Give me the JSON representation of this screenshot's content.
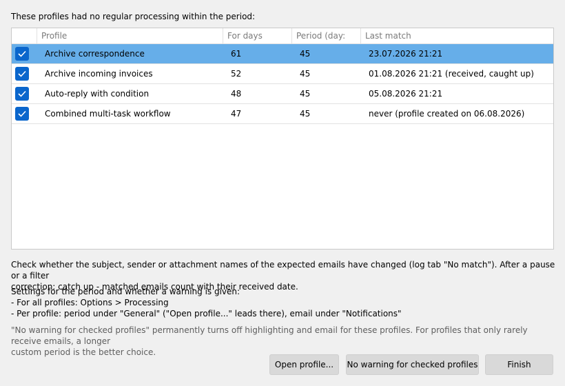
{
  "heading": "These profiles had no regular processing within the period:",
  "table": {
    "columns": {
      "profile": "Profile",
      "days": "For days",
      "period": "Period (day:",
      "last": "Last match"
    },
    "rows": [
      {
        "checked": true,
        "selected": true,
        "profile": "Archive correspondence",
        "days": "61",
        "period": "45",
        "last": "23.07.2026 21:21"
      },
      {
        "checked": true,
        "selected": false,
        "profile": "Archive incoming invoices",
        "days": "52",
        "period": "45",
        "last": "01.08.2026 21:21 (received, caught up)"
      },
      {
        "checked": true,
        "selected": false,
        "profile": "Auto-reply with condition",
        "days": "48",
        "period": "45",
        "last": "05.08.2026 21:21"
      },
      {
        "checked": true,
        "selected": false,
        "profile": "Combined multi-task workflow",
        "days": "47",
        "period": "45",
        "last": "never (profile created on 06.08.2026)"
      }
    ]
  },
  "hint": {
    "line1": "Check whether the subject, sender or attachment names of the expected emails have changed (log tab \"No match\"). After a pause or a filter",
    "line2": "correction: catch up - matched emails count with their received date."
  },
  "settings": {
    "line1": "Settings for the period and whether a warning is given:",
    "line2": "- For all profiles: Options > Processing",
    "line3": "- Per profile: period under \"General\" (\"Open profile...\" leads there), email under \"Notifications\""
  },
  "note": {
    "line1": "\"No warning for checked profiles\" permanently turns off highlighting and email for these profiles. For profiles that only rarely receive emails, a longer",
    "line2": "custom period is the better choice."
  },
  "buttons": {
    "open": "Open profile...",
    "no_warning": "No warning for checked profiles",
    "finish": "Finish"
  },
  "colors": {
    "selected_row": "#66aee9",
    "checkbox": "#0a66cc"
  }
}
